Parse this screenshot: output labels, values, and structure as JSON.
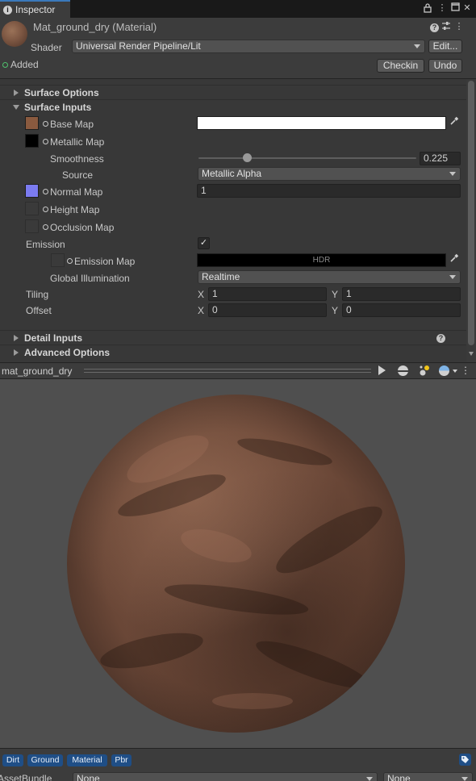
{
  "tab": {
    "title": "Inspector"
  },
  "header": {
    "material_title": "Mat_ground_dry (Material)",
    "shader_label": "Shader",
    "shader_value": "Universal Render Pipeline/Lit",
    "edit_label": "Edit...",
    "vcs_status": "Added",
    "checkin_label": "Checkin",
    "undo_label": "Undo"
  },
  "sections": {
    "surface_options": "Surface Options",
    "surface_inputs": "Surface Inputs",
    "detail_inputs": "Detail Inputs",
    "advanced_options": "Advanced Options"
  },
  "surface_inputs": {
    "base_map": {
      "label": "Base Map",
      "swatch_color": "#8a5a3f",
      "color": "#ffffff"
    },
    "metallic_map": {
      "label": "Metallic Map",
      "swatch_color": "#000000"
    },
    "smoothness": {
      "label": "Smoothness",
      "value": "0.225",
      "fraction": 0.225
    },
    "source": {
      "label": "Source",
      "value": "Metallic Alpha"
    },
    "normal_map": {
      "label": "Normal Map",
      "swatch_color": "#7b7bf0",
      "value": "1"
    },
    "height_map": {
      "label": "Height Map"
    },
    "occlusion_map": {
      "label": "Occlusion Map"
    },
    "emission": {
      "label": "Emission",
      "checked": true
    },
    "emission_map": {
      "label": "Emission Map",
      "hdr_label": "HDR"
    },
    "global_illumination": {
      "label": "Global Illumination",
      "value": "Realtime"
    },
    "tiling": {
      "label": "Tiling",
      "x_label": "X",
      "x": "1",
      "y_label": "Y",
      "y": "1"
    },
    "offset": {
      "label": "Offset",
      "x_label": "X",
      "x": "0",
      "y_label": "Y",
      "y": "0"
    }
  },
  "preview": {
    "title": "mat_ground_dry"
  },
  "tags": [
    "Dirt",
    "Ground",
    "Material",
    "Pbr"
  ],
  "assetbundle": {
    "label": "AssetBundle",
    "name": "None",
    "variant": "None"
  },
  "colors": {
    "accent": "#3a79bb",
    "tag_bg": "#1f4e86",
    "status_green": "#4fc16d"
  }
}
